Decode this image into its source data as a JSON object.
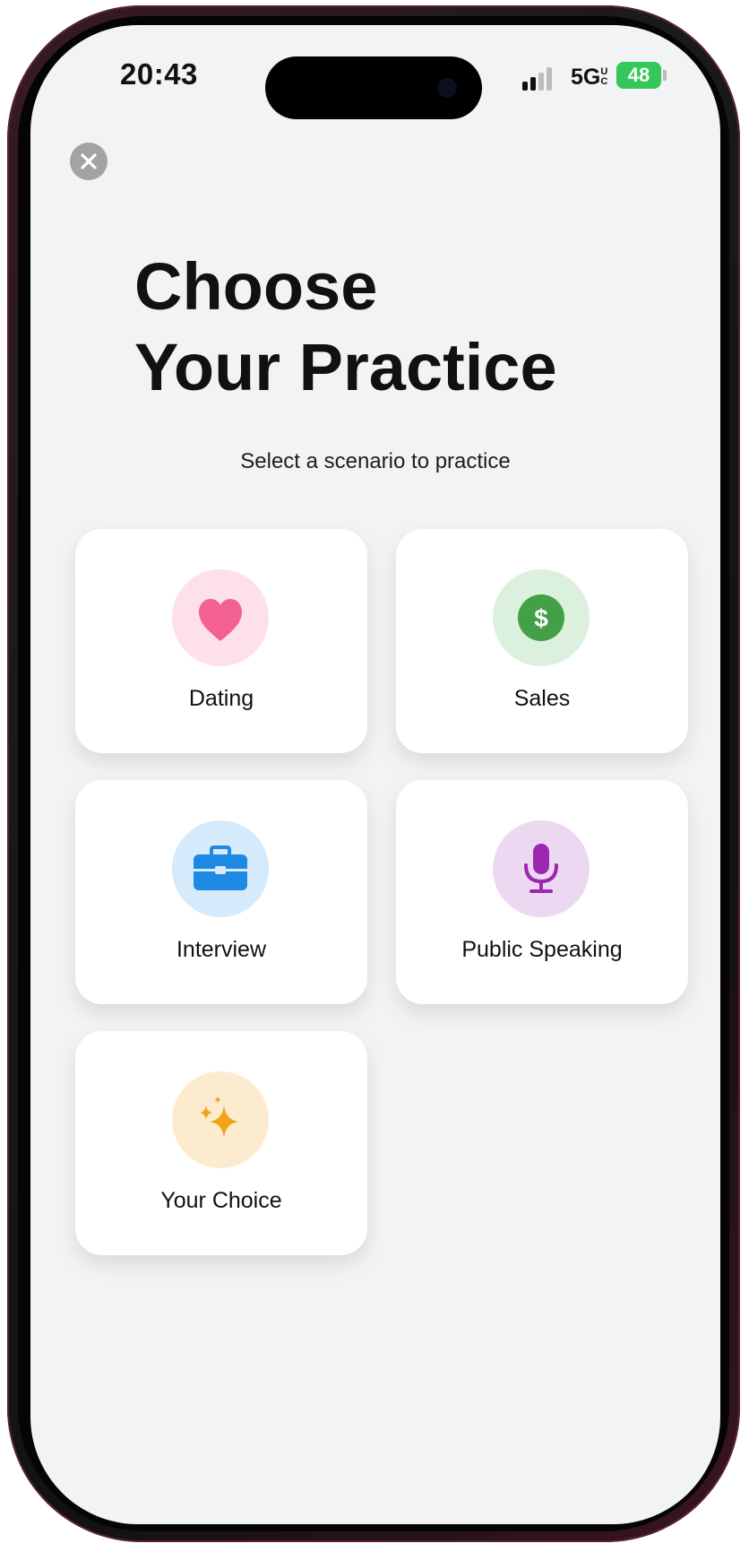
{
  "status_bar": {
    "time": "20:43",
    "network": "5G",
    "network_suffix": "UC",
    "battery": "48"
  },
  "header": {
    "title_line_1": "Choose",
    "title_line_2": "Your Practice",
    "subtitle": "Select a scenario to practice"
  },
  "scenarios": [
    {
      "label": "Dating",
      "icon": "heart-icon",
      "icon_color": "#f2618f",
      "bg_color": "#fde0ea"
    },
    {
      "label": "Sales",
      "icon": "dollar-icon",
      "icon_color": "#43a047",
      "bg_color": "#dbf0dd"
    },
    {
      "label": "Interview",
      "icon": "briefcase-icon",
      "icon_color": "#1e88e5",
      "bg_color": "#d5eafb"
    },
    {
      "label": "Public Speaking",
      "icon": "microphone-icon",
      "icon_color": "#9c27b0",
      "bg_color": "#ecd9f1"
    },
    {
      "label": "Your Choice",
      "icon": "sparkles-icon",
      "icon_color": "#f0a318",
      "bg_color": "#fdebcf"
    }
  ],
  "colors": {
    "screen_bg": "#f2f3f5",
    "card_bg": "#ffffff",
    "battery": "#34c759"
  }
}
